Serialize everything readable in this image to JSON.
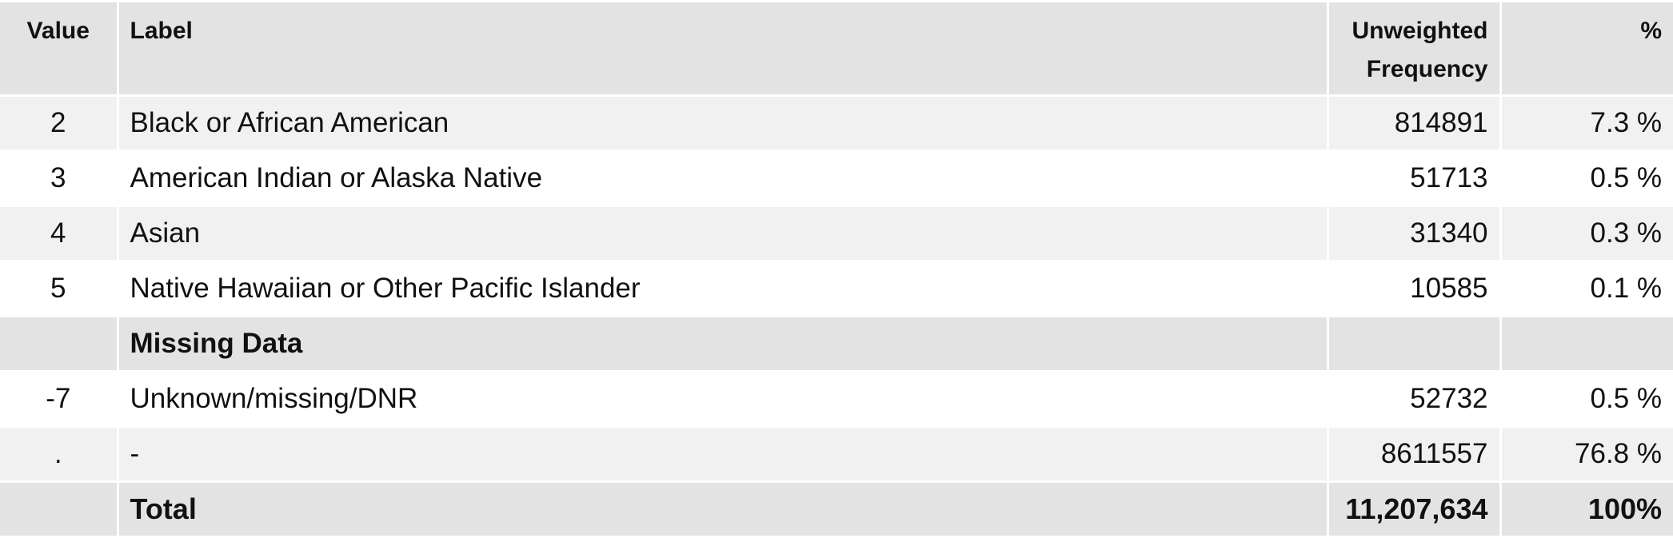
{
  "headers": {
    "value": "Value",
    "label": "Label",
    "frequency_line1": "Unweighted",
    "frequency_line2": "Frequency",
    "percent": "%"
  },
  "rows": [
    {
      "value": "2",
      "label": "Black or African American",
      "frequency": "814891",
      "percent": "7.3 %"
    },
    {
      "value": "3",
      "label": "American Indian or Alaska Native",
      "frequency": "51713",
      "percent": "0.5 %"
    },
    {
      "value": "4",
      "label": "Asian",
      "frequency": "31340",
      "percent": "0.3 %"
    },
    {
      "value": "5",
      "label": "Native Hawaiian or Other Pacific Islander",
      "frequency": "10585",
      "percent": "0.1 %"
    }
  ],
  "missing_section": {
    "title": "Missing Data",
    "rows": [
      {
        "value": "-7",
        "label": "Unknown/missing/DNR",
        "frequency": "52732",
        "percent": "0.5 %"
      },
      {
        "value": ".",
        "label": "-",
        "frequency": "8611557",
        "percent": "76.8 %"
      }
    ]
  },
  "total": {
    "label": "Total",
    "frequency": "11,207,634",
    "percent": "100%"
  }
}
